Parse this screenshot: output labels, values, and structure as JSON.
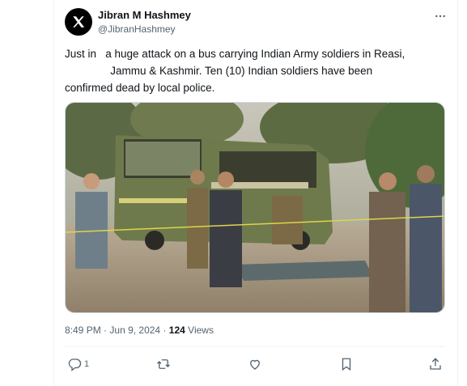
{
  "tweet": {
    "author_name": "Jibran M Hashmey",
    "author_handle": "@JibranHashmey",
    "text_lines": [
      "Just in   a huge attack on a bus carrying Indian Army soldiers in Reasi,",
      "               Jammu & Kashmir. Ten (10) Indian soldiers have been",
      "confirmed dead by local police."
    ],
    "time": "8:49 PM",
    "date": "Jun 9, 2024",
    "views_count": "124",
    "views_label": "Views",
    "separator": "·"
  },
  "actions": {
    "reply_count": "1"
  },
  "icons": {
    "logo": "x-logo-icon",
    "more": "more-icon",
    "reply": "reply-icon",
    "retweet": "retweet-icon",
    "like": "like-icon",
    "bookmark": "bookmark-icon",
    "share": "share-icon"
  },
  "colors": {
    "text_primary": "#0f1419",
    "text_secondary": "#536471",
    "border": "#cfd9de"
  }
}
